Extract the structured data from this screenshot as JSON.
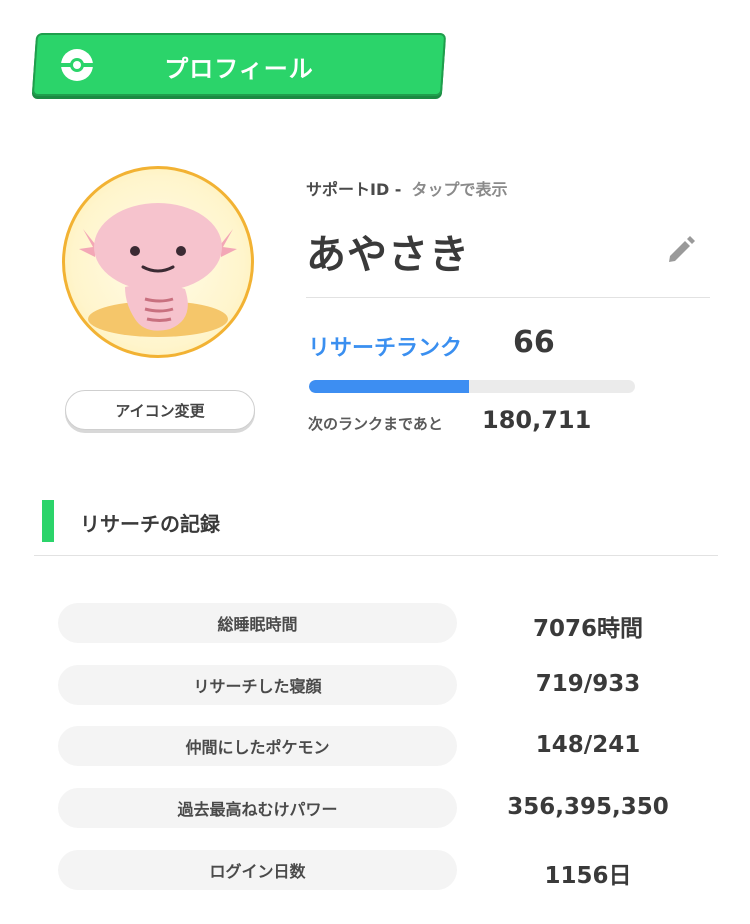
{
  "header": {
    "title": "プロフィール",
    "icon": "pokeball-icon"
  },
  "avatar": {
    "change_label": "アイコン変更"
  },
  "profile": {
    "support_id_label": "サポートID -",
    "support_id_hint": "タップで表示",
    "username": "あやさき",
    "edit_icon": "pencil-icon"
  },
  "rank": {
    "label": "リサーチランク",
    "value": "66",
    "progress": 0.49,
    "next_label": "次のランクまであと",
    "next_value": "180,711"
  },
  "records": {
    "title": "リサーチの記録",
    "items": [
      {
        "label": "総睡眠時間",
        "value": "7076時間"
      },
      {
        "label": "リサーチした寝顔",
        "value": "719/933"
      },
      {
        "label": "仲間にしたポケモン",
        "value": "148/241"
      },
      {
        "label": "過去最高ねむけパワー",
        "value": "356,395,350"
      },
      {
        "label": "ログイン日数",
        "value": "1156日"
      }
    ]
  },
  "colors": {
    "accent_green": "#2bd46a",
    "rank_blue": "#3a8ff0"
  }
}
